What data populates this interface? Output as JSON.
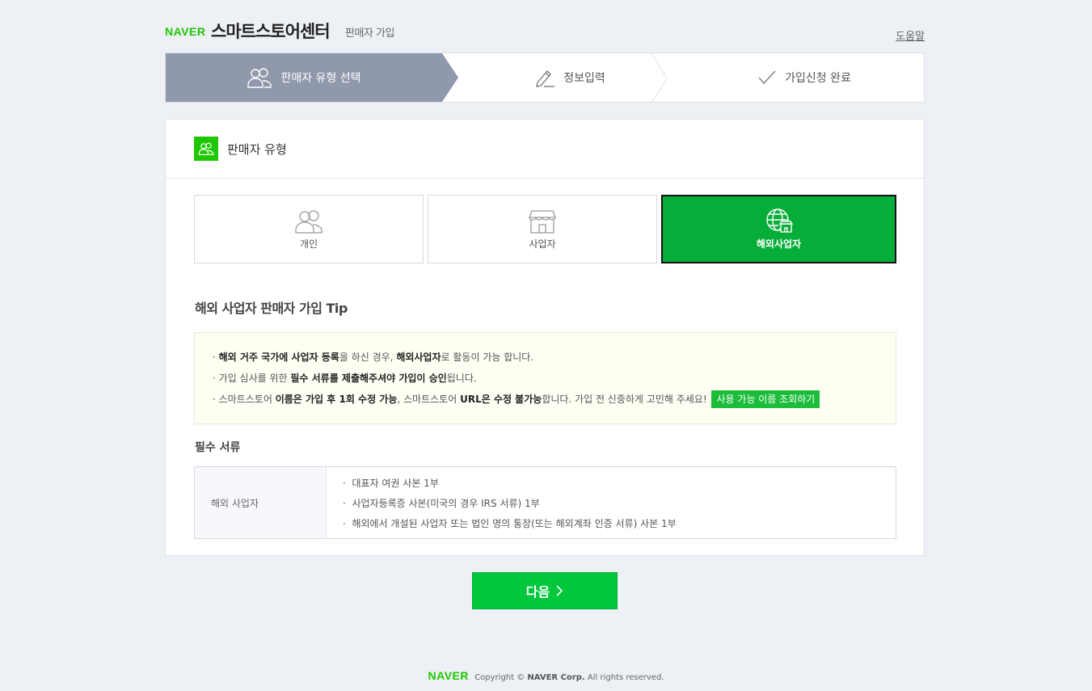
{
  "header": {
    "brand": "NAVER",
    "title": "스마트스토어센터",
    "subtitle": "판매자 가입",
    "help": "도움말"
  },
  "steps": [
    {
      "label": "판매자 유형 선택",
      "icon": "users-icon",
      "active": true
    },
    {
      "label": "정보입력",
      "icon": "pencil-icon",
      "active": false
    },
    {
      "label": "가입신청 완료",
      "icon": "check-icon",
      "active": false
    }
  ],
  "card": {
    "title": "판매자 유형",
    "types": [
      {
        "label": "개인",
        "icon": "person-icon",
        "selected": false
      },
      {
        "label": "사업자",
        "icon": "store-icon",
        "selected": false
      },
      {
        "label": "해외사업자",
        "icon": "globe-store-icon",
        "selected": true
      }
    ],
    "tip_title": "해외 사업자 판매자 가입 Tip",
    "tips": {
      "l1": {
        "b1": "해외 거주 국가에 사업자 등록",
        "t1": "을 하신 경우, ",
        "b2": "해외사업자",
        "t2": "로 활동이 가능 합니다."
      },
      "l2": {
        "t1": "가입 심사를 위한 ",
        "b1": "필수 서류를 제출해주셔야 가입이 승인",
        "t2": "됩니다."
      },
      "l3": {
        "t1": "스마트스토어 ",
        "b1": "이름은 가입 후 1회 수정 가능",
        "t2": ", 스마트스토어 ",
        "b2": "URL은 수정 불가능",
        "t3": "합니다. 가입 전 신중하게 고민해 주세요!",
        "button": "사용 가능 이름 조회하기"
      }
    },
    "required_title": "필수 서류",
    "required": {
      "label": "해외 사업자",
      "items": [
        "대표자 여권 사본 1부",
        "사업자등록증 사본(미국의 경우 IRS 서류) 1부",
        "해외에서 개설된 사업자 또는 법인 명의 통장(또는 해외계좌 인증 서류) 사본 1부"
      ]
    }
  },
  "next_button": "다음",
  "footer": {
    "brand": "NAVER",
    "copyright": "Copyright ©",
    "corp": "NAVER Corp.",
    "rights": "All rights reserved."
  },
  "colors": {
    "brand_green": "#03c75a",
    "selected_green": "#06ae39",
    "step_active": "#8f99ab",
    "background": "#edf0f5"
  }
}
